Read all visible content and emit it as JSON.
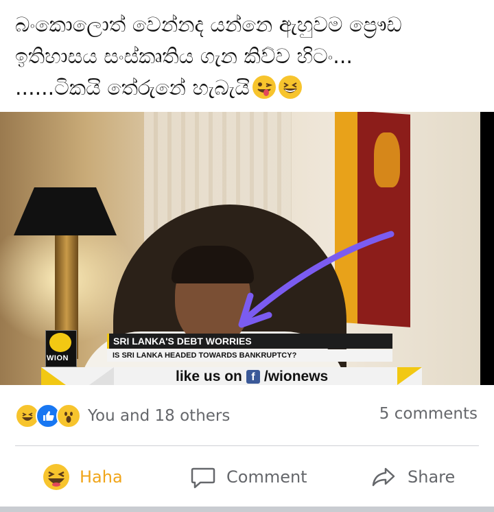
{
  "post": {
    "line1": "බංකොලොත් වෙන්නද යන්නෙ ඇහුවම ප්‍රෞඩ",
    "line2": "ඉතිහාසය සංස්කෘතිය ගැන කිව්ව හිටං...",
    "line3": "......ටිකයි තේරුනේ හැබැයි"
  },
  "video": {
    "channel_logo": "WION",
    "headline": "SRI LANKA'S DEBT WORRIES",
    "subheadline": "IS SRI LANKA HEADED TOWARDS BANKRUPTCY?",
    "social_prefix": "like us on",
    "social_handle": "/wionews",
    "social_icon": "facebook-icon"
  },
  "reactions": {
    "icons": [
      "haha-icon",
      "like-icon",
      "wow-icon"
    ],
    "summary": "You and 18 others",
    "comments": "5 comments"
  },
  "actions": {
    "haha": "Haha",
    "comment": "Comment",
    "share": "Share"
  },
  "colors": {
    "haha_active": "#f0a51a",
    "like_blue": "#1877f2",
    "muted_text": "#65676b",
    "emoji_yellow": "#f7c42d",
    "arrow_purple": "#7b5cf0"
  }
}
